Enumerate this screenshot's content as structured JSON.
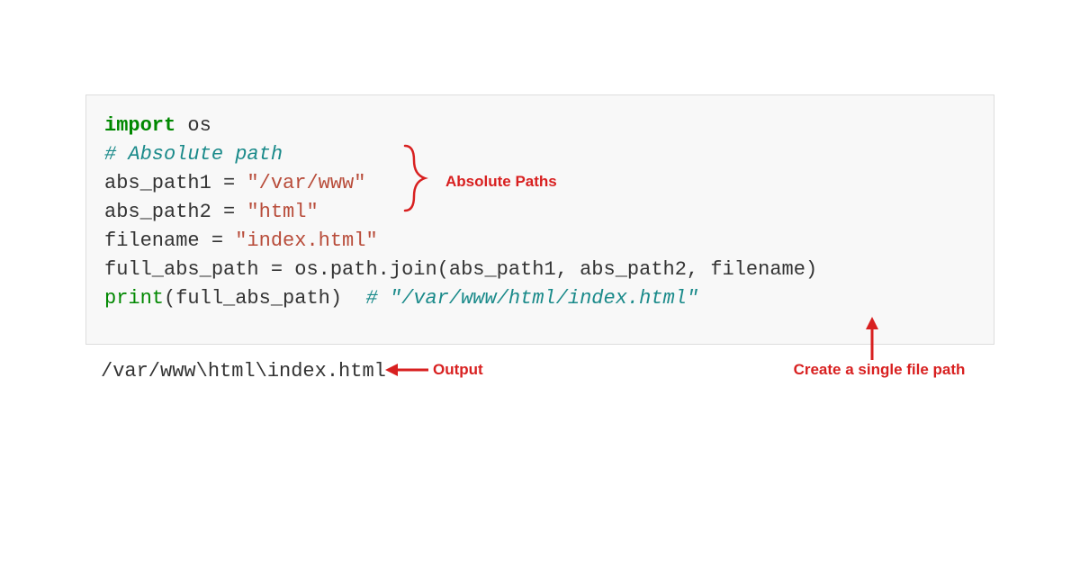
{
  "code": {
    "line1_import": "import",
    "line1_module": " os",
    "line2_blank": "",
    "line3_comment": "# Absolute path",
    "line4_var": "abs_path1 ",
    "line4_op": "=",
    "line4_str": " \"/var/www\"",
    "line5_var": "abs_path2 ",
    "line5_op": "=",
    "line5_str": " \"html\"",
    "line6_var": "filename ",
    "line6_op": "=",
    "line6_str": " \"index.html\"",
    "line7_var": "full_abs_path ",
    "line7_op": "=",
    "line7_fn": " os.path.join(abs_path1, abs_path2, filename)",
    "line8_pr": "print",
    "line8_paren_open": "(",
    "line8_arg": "full_abs_path",
    "line8_paren_close": ")  ",
    "line8_comment": "# \"/var/www/html/index.html\""
  },
  "output": "/var/www\\html\\index.html",
  "annotations": {
    "absolute_paths": "Absolute Paths",
    "output_label": "Output",
    "single_file": "Create a single file path"
  },
  "colors": {
    "annotation": "#d82020",
    "code_bg": "#f8f8f8",
    "code_border": "#dddddd"
  }
}
